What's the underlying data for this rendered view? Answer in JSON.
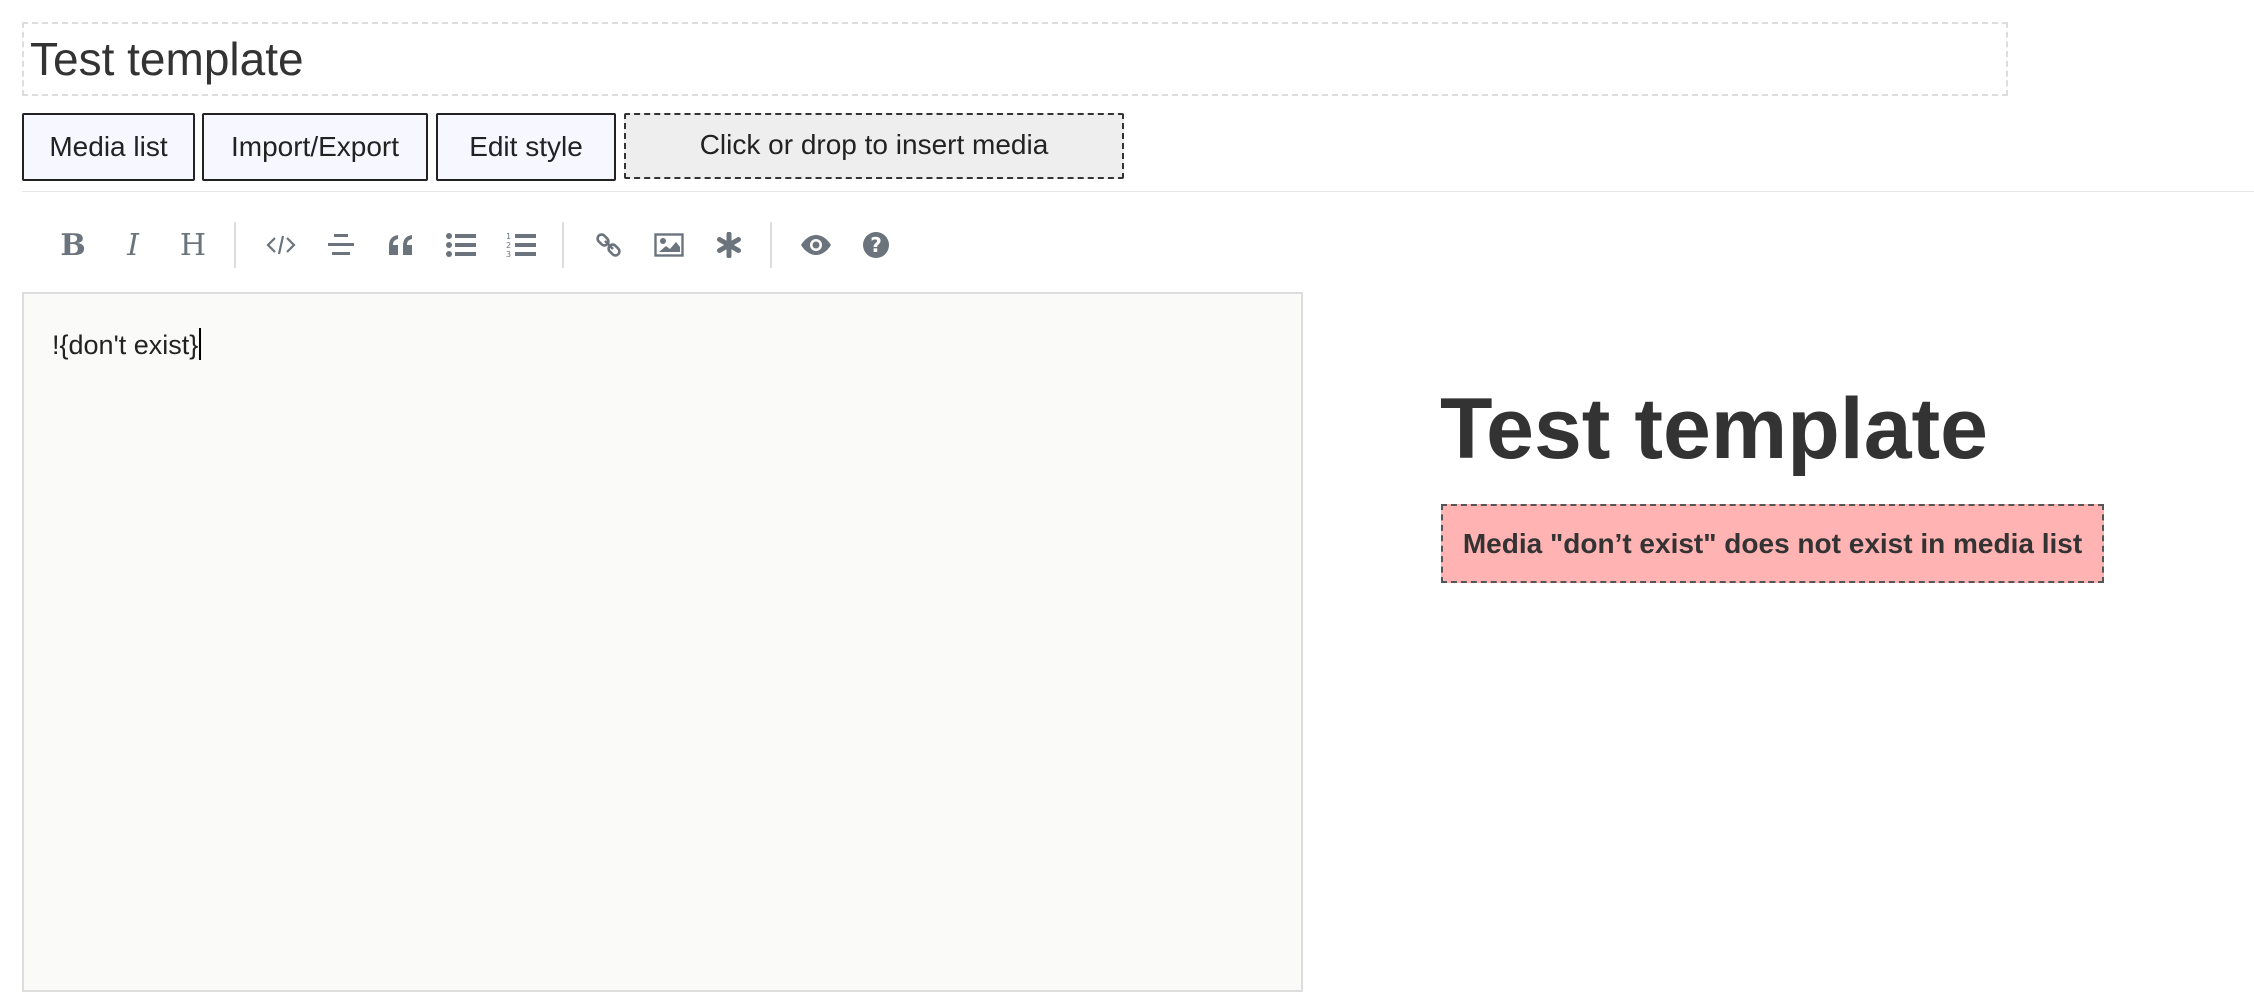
{
  "header": {
    "title_value": "Test template"
  },
  "actions": {
    "media_list_label": "Media list",
    "import_export_label": "Import/Export",
    "edit_style_label": "Edit style",
    "drop_zone_label": "Click or drop to insert media"
  },
  "toolbar": {
    "items": [
      {
        "name": "bold-icon",
        "tooltip": "Bold"
      },
      {
        "name": "italic-icon",
        "tooltip": "Italic"
      },
      {
        "name": "heading-icon",
        "tooltip": "Heading"
      },
      {
        "name": "code-icon",
        "tooltip": "Code"
      },
      {
        "name": "center-align-icon",
        "tooltip": "Center"
      },
      {
        "name": "quote-icon",
        "tooltip": "Quote"
      },
      {
        "name": "unordered-list-icon",
        "tooltip": "Generic List"
      },
      {
        "name": "ordered-list-icon",
        "tooltip": "Numbered List"
      },
      {
        "name": "link-icon",
        "tooltip": "Create Link"
      },
      {
        "name": "image-icon",
        "tooltip": "Insert Image"
      },
      {
        "name": "asterisk-icon",
        "tooltip": "Special"
      },
      {
        "name": "eye-icon",
        "tooltip": "Toggle Preview"
      },
      {
        "name": "question-circle-icon",
        "tooltip": "Help"
      }
    ]
  },
  "editor": {
    "content": "!{don't exist}"
  },
  "preview": {
    "title": "Test template",
    "error_message": "Media \"don’t exist\" does not exist in media list",
    "error_bg": "#ffb3b3"
  }
}
